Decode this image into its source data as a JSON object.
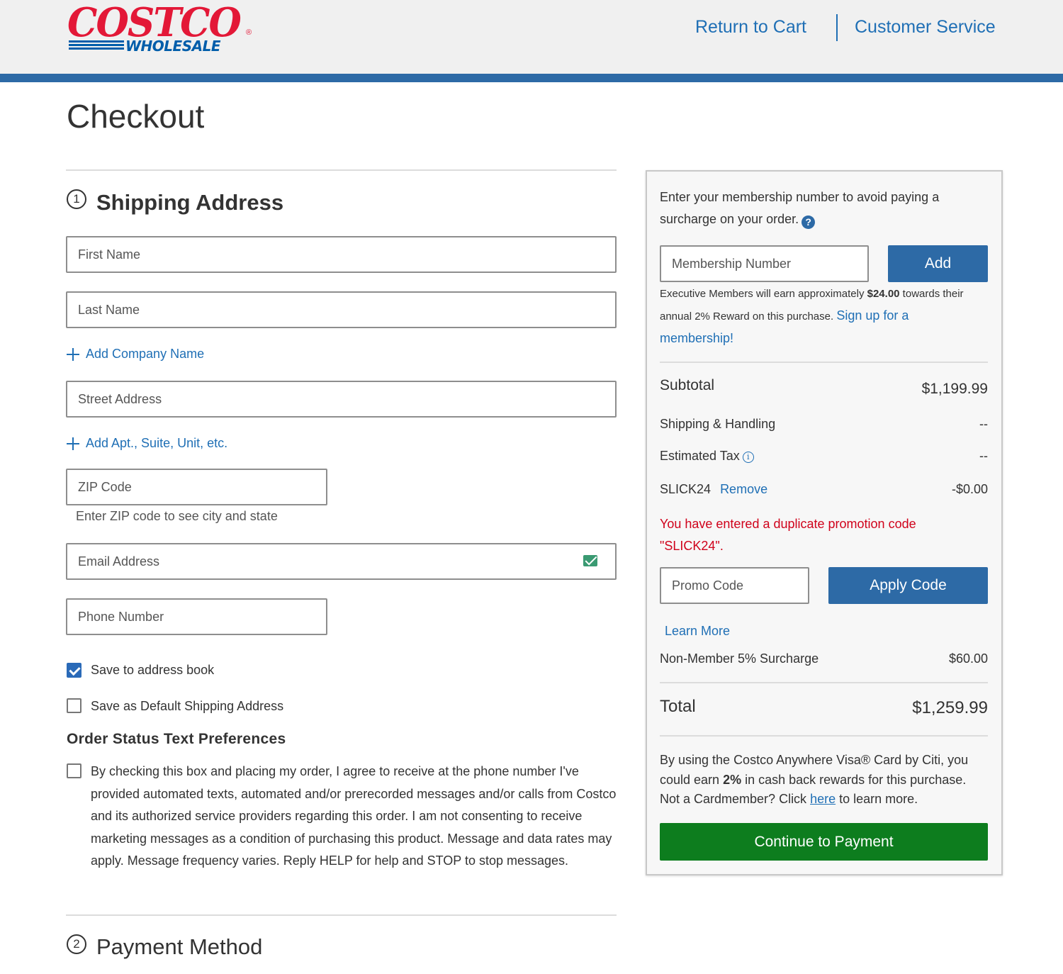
{
  "header": {
    "logo_brand": "COSTCO",
    "logo_sub": "WHOLESALE",
    "logo_reg": "®",
    "return_to_cart": "Return to Cart",
    "customer_service": "Customer Service"
  },
  "page_title": "Checkout",
  "shipping": {
    "step_number": "1",
    "title": "Shipping Address",
    "first_name_placeholder": "First Name",
    "last_name_placeholder": "Last Name",
    "add_company": "Add Company Name",
    "street_placeholder": "Street Address",
    "add_apt": "Add Apt., Suite, Unit, etc.",
    "zip_placeholder": "ZIP Code",
    "zip_hint": "Enter ZIP code to see city and state",
    "email_placeholder": "Email Address",
    "phone_placeholder": "Phone Number",
    "save_address_book": "Save to address book",
    "save_address_book_checked": true,
    "save_default": "Save as Default Shipping Address",
    "save_default_checked": false,
    "text_prefs_title": "Order Status Text Preferences",
    "consent_text": "By checking this box and placing my order, I agree to receive at the phone number I've provided automated texts, automated and/or prerecorded messages and/or calls from Costco and its authorized service providers regarding this order. I am not consenting to receive marketing messages as a condition of purchasing this product. Message and data rates may apply. Message frequency varies. Reply HELP for help and STOP to stop messages.",
    "consent_checked": false
  },
  "payment": {
    "step_number": "2",
    "title": "Payment Method"
  },
  "summary": {
    "membership_prompt": "Enter your membership number to avoid paying a surcharge on your order.",
    "help_icon": "?",
    "membership_placeholder": "Membership Number",
    "add_button": "Add",
    "exec_text_1": "Executive Members will earn approximately ",
    "exec_amount": "$24.00",
    "exec_text_2": " towards their annual 2% Reward on this purchase. ",
    "signup_link": "Sign up for a membership",
    "signup_punct": "!",
    "subtotal_label": "Subtotal",
    "subtotal_value": "$1,199.99",
    "shipping_label": "Shipping & Handling",
    "shipping_value": "--",
    "tax_label": "Estimated Tax",
    "tax_value": "--",
    "promo_applied_code": "SLICK24",
    "remove_link": "Remove",
    "promo_applied_value": "-$0.00",
    "promo_error": "You have entered a duplicate promotion code \"SLICK24\".",
    "promo_placeholder": "Promo Code",
    "apply_button": "Apply Code",
    "learn_more": "Learn More",
    "surcharge_label": "Non-Member 5% Surcharge",
    "surcharge_value": "$60.00",
    "total_label": "Total",
    "total_value": "$1,259.99",
    "visa_text_1": "By using the Costco Anywhere Visa® Card by Citi, you could earn ",
    "visa_pct": "2%",
    "visa_text_2": " in cash back rewards for this purchase. Not a Cardmember? Click ",
    "visa_here": "here",
    "visa_text_3": " to learn more.",
    "continue_button": "Continue to Payment"
  },
  "colors": {
    "brand_red": "#e31837",
    "brand_blue": "#005daa",
    "link_blue": "#1f6fb5",
    "button_blue": "#2d6aa6",
    "button_green": "#0d7d1e",
    "error_red": "#d0021b"
  }
}
